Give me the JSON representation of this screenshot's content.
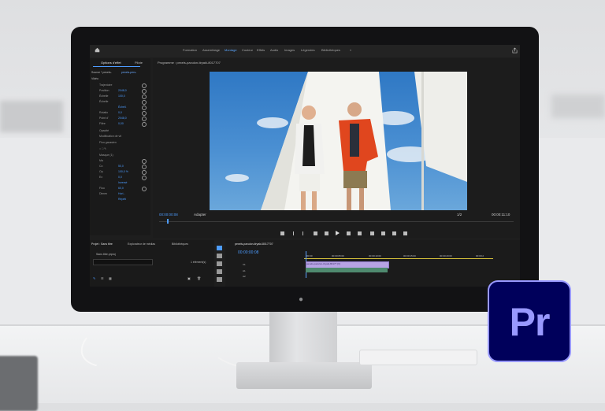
{
  "app": {
    "name": "Adobe Premiere Pro",
    "logo_text": "Pr",
    "logo_bg": "#00005B",
    "logo_fg": "#9999FF",
    "accent": "#4D9CFF"
  },
  "workspaces": [
    "Formation",
    "Assemblage",
    "Montage",
    "Couleur",
    "Effets",
    "Audio",
    "Images",
    "Légendes",
    "Bibliothèques"
  ],
  "active_workspace": "Montage",
  "effect_controls": {
    "tabs": [
      "Options d'effet",
      "Pilote"
    ],
    "source_label": "Source * pexels-",
    "source_value": "pexels-pers-",
    "section_video": "Vidéo",
    "rows": [
      {
        "label": "Trajectoire",
        "value": ""
      },
      {
        "label": "Position",
        "value": "2048,0"
      },
      {
        "label": "Échelle",
        "value": "100,0"
      },
      {
        "label": "Échelle",
        "value": ""
      },
      {
        "label": "",
        "value": "Échell."
      },
      {
        "label": "Rotatio",
        "value": "0,0"
      },
      {
        "label": "Point d'",
        "value": "2048,0"
      },
      {
        "label": "Filtre",
        "value": "0,00"
      },
      {
        "label": "Opacité",
        "value": ""
      },
      {
        "label": "Modification de vit",
        "value": ""
      },
      {
        "label": "Flou gaussien",
        "value": ""
      },
      {
        "label": "Masque (1)",
        "value": ""
      },
      {
        "label": "Ma",
        "value": ""
      },
      {
        "label": "Co",
        "value": "50,0"
      },
      {
        "label": "Op",
        "value": "100,0 %"
      },
      {
        "label": "Ex",
        "value": "0,0"
      },
      {
        "label": "",
        "value": "Inversé"
      },
      {
        "label": "Flou",
        "value": "60,0"
      },
      {
        "label": "Dimen",
        "value": "Hori..."
      },
      {
        "label": "",
        "value": "Répéti"
      }
    ],
    "footer_timecode": "00:00:00:00"
  },
  "program_monitor": {
    "title": "Programme : pexels-pavulon-tiryaki-8017707",
    "timecode_current": "00:00:00:08",
    "fit_label": "Adapter",
    "resolution": "1/2",
    "timecode_duration": "00:00:11:10"
  },
  "project_panel": {
    "tabs": [
      "Projet : Sans titre",
      "Explorateur de médias",
      "Bibliothèques"
    ],
    "project_file": "Sans titre.prproj",
    "item_count": "1 élément(s)"
  },
  "timeline": {
    "tab": "pexels-pavulon-tiryaki-8017707",
    "timecode": "00:00:00:08",
    "ruler": [
      "00:00",
      "00:00:05:00",
      "00:00:10:00",
      "00:00:15:00",
      "00:00:20:00",
      "00:00:2"
    ],
    "clip_label": "pexels-pavulon-tiryaki-80177 [V]",
    "tracks": [
      "V1",
      "A1",
      "A2"
    ]
  },
  "icons": [
    "home-icon",
    "share-icon",
    "selection-tool-icon",
    "razor-tool-icon",
    "play-icon",
    "apple-logo-icon"
  ]
}
